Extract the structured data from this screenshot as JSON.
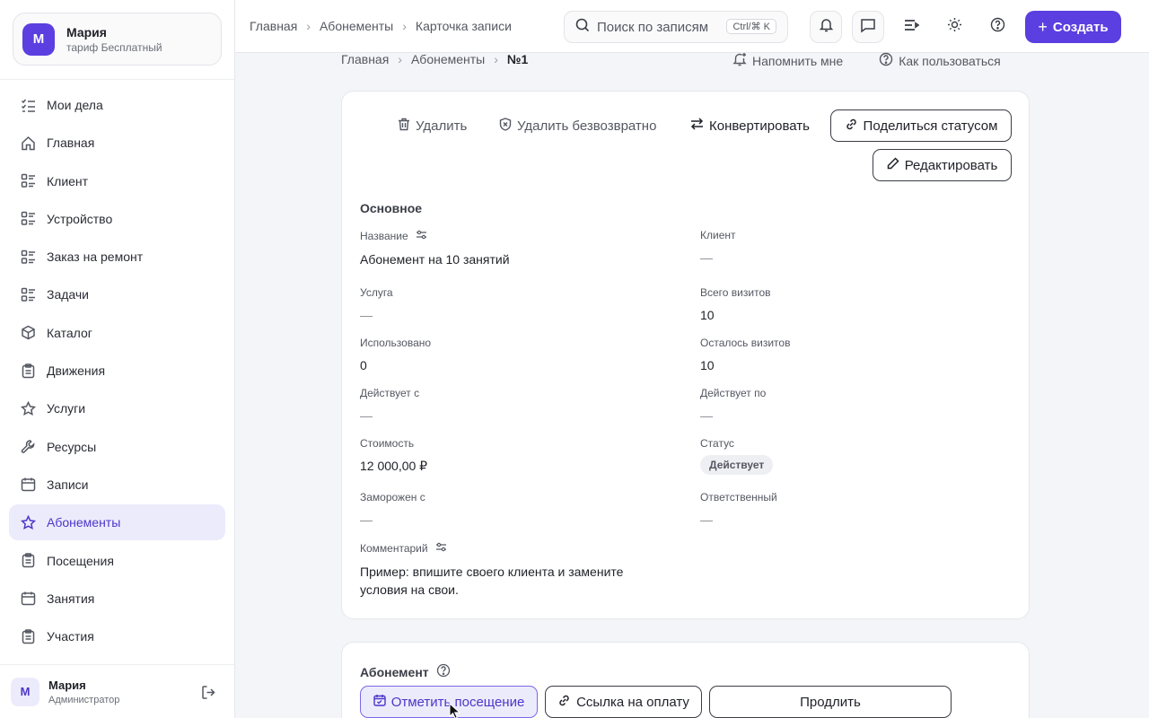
{
  "account": {
    "initial": "М",
    "name": "Мария",
    "plan": "тариф Бесплатный"
  },
  "sidebar": {
    "items": [
      {
        "label": "Мои дела",
        "icon": "checklist-icon"
      },
      {
        "label": "Главная",
        "icon": "home-icon"
      },
      {
        "label": "Клиент",
        "icon": "list-icon"
      },
      {
        "label": "Устройство",
        "icon": "list-icon"
      },
      {
        "label": "Заказ на ремонт",
        "icon": "list-icon"
      },
      {
        "label": "Задачи",
        "icon": "list-icon"
      },
      {
        "label": "Каталог",
        "icon": "box-icon"
      },
      {
        "label": "Движения",
        "icon": "clipboard-icon"
      },
      {
        "label": "Услуги",
        "icon": "star-icon"
      },
      {
        "label": "Ресурсы",
        "icon": "wrench-icon"
      },
      {
        "label": "Записи",
        "icon": "calendar-icon"
      },
      {
        "label": "Абонементы",
        "icon": "star-icon",
        "active": true
      },
      {
        "label": "Посещения",
        "icon": "clipboard-icon"
      },
      {
        "label": "Занятия",
        "icon": "calendar-icon"
      },
      {
        "label": "Участия",
        "icon": "clipboard-icon"
      }
    ]
  },
  "user": {
    "initial": "М",
    "name": "Мария",
    "role": "Администратор"
  },
  "topbar": {
    "crumbs": [
      "Главная",
      "Абонементы",
      "Карточка записи"
    ],
    "search_placeholder": "Поиск по записям",
    "search_shortcut": "Ctrl/⌘ K",
    "create_label": "Создать"
  },
  "page": {
    "crumbs": [
      "Главная",
      "Абонементы",
      "№1"
    ],
    "remind_label": "Напомнить мне",
    "howto_label": "Как пользоваться"
  },
  "actions": {
    "delete": "Удалить",
    "delete_forever": "Удалить безвозвратно",
    "convert": "Конвертировать",
    "share_status": "Поделиться статусом",
    "edit": "Редактировать"
  },
  "main_section": {
    "title": "Основное",
    "fields": {
      "name": {
        "label": "Название",
        "value": "Абонемент на 10 занятий"
      },
      "client": {
        "label": "Клиент",
        "value": "—"
      },
      "service": {
        "label": "Услуга",
        "value": "—"
      },
      "total_visits": {
        "label": "Всего визитов",
        "value": "10"
      },
      "used": {
        "label": "Использовано",
        "value": "0"
      },
      "visits_left": {
        "label": "Осталось визитов",
        "value": "10"
      },
      "valid_from": {
        "label": "Действует с",
        "value": "—"
      },
      "valid_to": {
        "label": "Действует по",
        "value": "—"
      },
      "price": {
        "label": "Стоимость",
        "value": "12 000,00 ₽"
      },
      "status": {
        "label": "Статус",
        "value": "Действует"
      },
      "frozen_from": {
        "label": "Заморожен с",
        "value": "—"
      },
      "responsible": {
        "label": "Ответственный",
        "value": "—"
      },
      "comment": {
        "label": "Комментарий",
        "value": "Пример: впишите своего клиента и замените условия на свои."
      }
    }
  },
  "subscription_section": {
    "title": "Абонемент",
    "mark_visit": "Отметить посещение",
    "payment_link": "Ссылка на оплату",
    "extend": "Продлить"
  }
}
